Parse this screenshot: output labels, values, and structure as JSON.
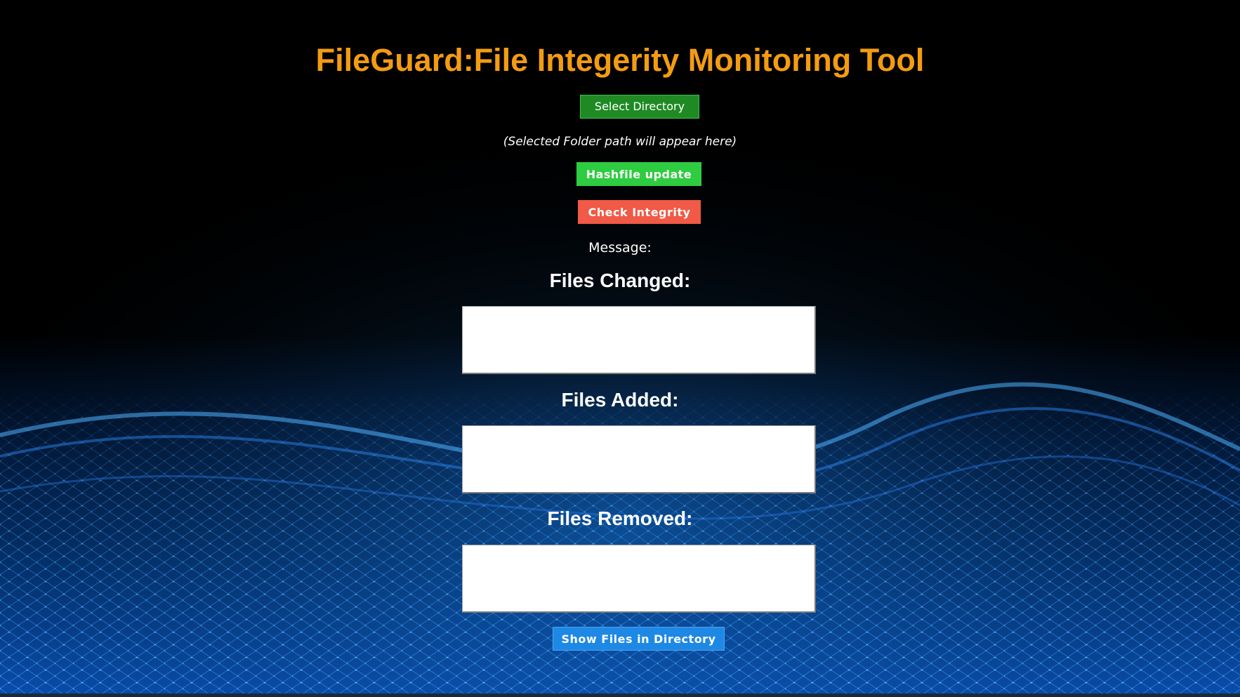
{
  "app": {
    "title": "FileGuard:File Integerity Monitoring Tool"
  },
  "controls": {
    "select_directory_label": "Select Directory",
    "selected_path_text": "(Selected Folder path will appear here)",
    "hashfile_update_label": "Hashfile update",
    "check_integrity_label": "Check Integrity",
    "message_label": "Message:",
    "show_files_label": "Show Files in Directory"
  },
  "sections": {
    "changed_heading": "Files Changed:",
    "added_heading": "Files Added:",
    "removed_heading": "Files Removed:"
  },
  "lists": {
    "changed": [],
    "added": [],
    "removed": []
  },
  "colors": {
    "title": "#f39c12",
    "select_button": "#1f8a24",
    "hashfile_button": "#2ecc40",
    "check_button": "#f05a46",
    "show_button": "#1e88e5",
    "background": "#000000",
    "wave": "#1e7bff"
  }
}
